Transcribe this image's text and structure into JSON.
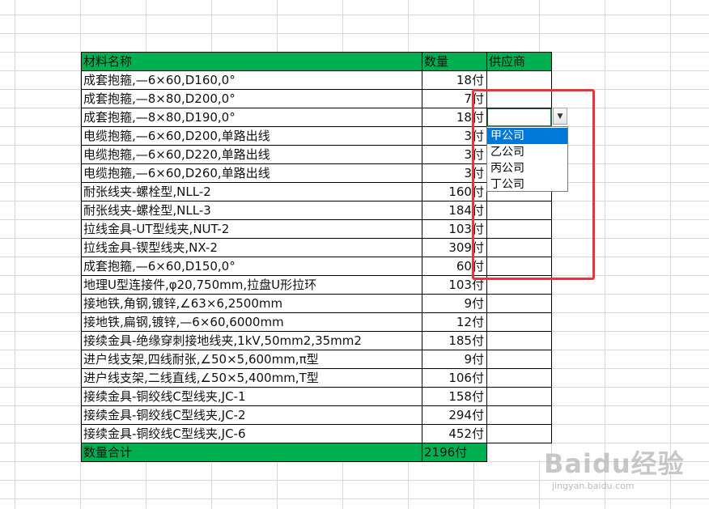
{
  "table": {
    "header": {
      "name": "材料名称",
      "qty": "数量",
      "supplier": "供应商"
    },
    "rows": [
      {
        "name": "成套抱箍,—6×60,D160,0°",
        "qty": "18",
        "unit": "付"
      },
      {
        "name": "成套抱箍,—8×80,D200,0°",
        "qty": "7",
        "unit": "付"
      },
      {
        "name": "成套抱箍,—8×80,D190,0°",
        "qty": "18",
        "unit": "付"
      },
      {
        "name": "电缆抱箍,—6×60,D200,单路出线",
        "qty": "3",
        "unit": "付"
      },
      {
        "name": "电缆抱箍,—6×60,D220,单路出线",
        "qty": "3",
        "unit": "付"
      },
      {
        "name": "电缆抱箍,—6×60,D260,单路出线",
        "qty": "3",
        "unit": "付"
      },
      {
        "name": "耐张线夹-螺栓型,NLL-2",
        "qty": "160",
        "unit": "付"
      },
      {
        "name": "耐张线夹-螺栓型,NLL-3",
        "qty": "184",
        "unit": "付"
      },
      {
        "name": "拉线金具-UT型线夹,NUT-2",
        "qty": "103",
        "unit": "付"
      },
      {
        "name": "拉线金具-锲型线夹,NX-2",
        "qty": "309",
        "unit": "付"
      },
      {
        "name": "成套抱箍,—6×60,D150,0°",
        "qty": "60",
        "unit": "付"
      },
      {
        "name": "地理U型连接件,φ20,750mm,拉盘U形拉环",
        "qty": "103",
        "unit": "付"
      },
      {
        "name": "接地铁,角钢,镀锌,∠63×6,2500mm",
        "qty": "9",
        "unit": "付"
      },
      {
        "name": "接地铁,扁钢,镀锌,—6×60,6000mm",
        "qty": "12",
        "unit": "付"
      },
      {
        "name": "接续金具-绝缘穿刺接地线夹,1kV,50mm2,35mm2",
        "qty": "185",
        "unit": "付"
      },
      {
        "name": "进户线支架,四线耐张,∠50×5,600mm,π型",
        "qty": "9",
        "unit": "付"
      },
      {
        "name": "进户线支架,二线直线,∠50×5,400mm,T型",
        "qty": "106",
        "unit": "付"
      },
      {
        "name": "接续金具-铜绞线C型线夹,JC-1",
        "qty": "158",
        "unit": "付"
      },
      {
        "name": "接续金具-铜绞线C型线夹,JC-2",
        "qty": "294",
        "unit": "付"
      },
      {
        "name": "接续金具-铜绞线C型线夹,JC-6",
        "qty": "452",
        "unit": "付"
      }
    ],
    "total": {
      "label": "数量合计",
      "value": "2196付"
    }
  },
  "dropdown": {
    "options": [
      "甲公司",
      "乙公司",
      "丙公司",
      "丁公司"
    ],
    "active_option": "甲公司",
    "arrow_icon": "triangle-down"
  },
  "watermark": {
    "logo": "Baidu经验",
    "sub": "jingyan.baidu.com"
  },
  "colors": {
    "header_fill": "#00b050",
    "highlight_border": "#e8343a",
    "active_option": "#0078d7"
  }
}
